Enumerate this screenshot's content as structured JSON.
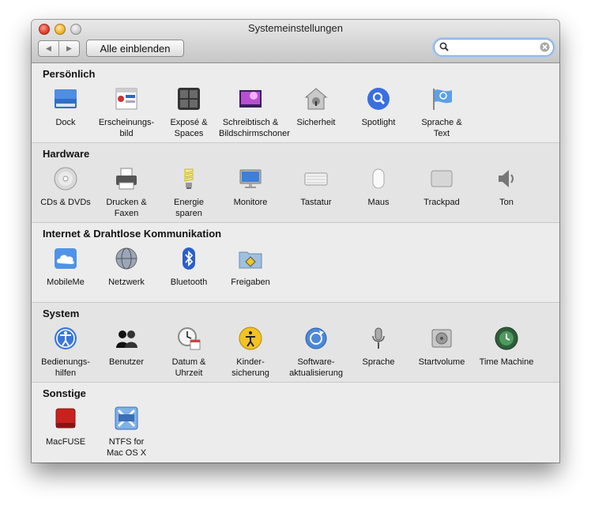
{
  "window": {
    "title": "Systemeinstellungen",
    "back_button": "◀",
    "forward_button": "▶",
    "show_all_button": "Alle einblenden",
    "search": {
      "value": "",
      "placeholder": ""
    }
  },
  "sections": [
    {
      "title": "Persönlich",
      "items": [
        {
          "label_lines": [
            "Dock"
          ],
          "icon": "dock-icon"
        },
        {
          "label_lines": [
            "Erscheinungs-",
            "bild"
          ],
          "icon": "appearance-icon"
        },
        {
          "label_lines": [
            "Exposé &",
            "Spaces"
          ],
          "icon": "expose-spaces-icon"
        },
        {
          "label_lines": [
            "Schreibtisch &",
            "Bildschirmschoner"
          ],
          "icon": "desktop-screensaver-icon"
        },
        {
          "label_lines": [
            "Sicherheit"
          ],
          "icon": "security-icon"
        },
        {
          "label_lines": [
            "Spotlight"
          ],
          "icon": "spotlight-icon"
        },
        {
          "label_lines": [
            "Sprache &",
            "Text"
          ],
          "icon": "language-text-icon"
        }
      ]
    },
    {
      "title": "Hardware",
      "items": [
        {
          "label_lines": [
            "CDs & DVDs"
          ],
          "icon": "cd-dvd-icon"
        },
        {
          "label_lines": [
            "Drucken &",
            "Faxen"
          ],
          "icon": "printer-icon"
        },
        {
          "label_lines": [
            "Energie",
            "sparen"
          ],
          "icon": "energy-bulb-icon"
        },
        {
          "label_lines": [
            "Monitore"
          ],
          "icon": "display-icon"
        },
        {
          "label_lines": [
            "Tastatur"
          ],
          "icon": "keyboard-icon"
        },
        {
          "label_lines": [
            "Maus"
          ],
          "icon": "mouse-icon"
        },
        {
          "label_lines": [
            "Trackpad"
          ],
          "icon": "trackpad-icon"
        },
        {
          "label_lines": [
            "Ton"
          ],
          "icon": "speaker-icon"
        }
      ]
    },
    {
      "title": "Internet & Drahtlose Kommunikation",
      "items": [
        {
          "label_lines": [
            "MobileMe"
          ],
          "icon": "mobileme-cloud-icon"
        },
        {
          "label_lines": [
            "Netzwerk"
          ],
          "icon": "network-globe-icon"
        },
        {
          "label_lines": [
            "Bluetooth"
          ],
          "icon": "bluetooth-icon"
        },
        {
          "label_lines": [
            "Freigaben"
          ],
          "icon": "sharing-folder-icon"
        }
      ]
    },
    {
      "title": "System",
      "items": [
        {
          "label_lines": [
            "Bedienungs-",
            "hilfen"
          ],
          "icon": "accessibility-icon"
        },
        {
          "label_lines": [
            "Benutzer"
          ],
          "icon": "users-icon"
        },
        {
          "label_lines": [
            "Datum &",
            "Uhrzeit"
          ],
          "icon": "date-time-icon"
        },
        {
          "label_lines": [
            "Kinder-",
            "sicherung"
          ],
          "icon": "parental-controls-icon"
        },
        {
          "label_lines": [
            "Software-",
            "aktualisierung"
          ],
          "icon": "software-update-icon"
        },
        {
          "label_lines": [
            "Sprache"
          ],
          "icon": "microphone-icon"
        },
        {
          "label_lines": [
            "Startvolume"
          ],
          "icon": "startup-disk-icon"
        },
        {
          "label_lines": [
            "Time Machine"
          ],
          "icon": "time-machine-icon"
        }
      ]
    },
    {
      "title": "Sonstige",
      "items": [
        {
          "label_lines": [
            "MacFUSE"
          ],
          "icon": "macfuse-icon"
        },
        {
          "label_lines": [
            "NTFS for",
            "Mac OS X"
          ],
          "icon": "ntfs-icon"
        }
      ]
    }
  ]
}
